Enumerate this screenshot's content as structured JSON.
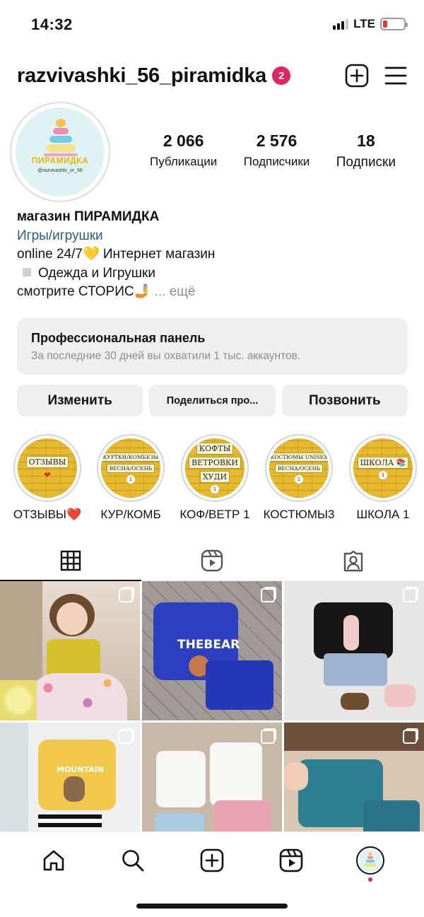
{
  "status": {
    "time": "14:32",
    "network": "LTE",
    "battery_color": "#e53935",
    "battery_level": 0.2
  },
  "header": {
    "username": "razvivashki_56_piramidka",
    "notifications": "2",
    "icons": [
      "new-post-icon",
      "menu-icon"
    ]
  },
  "profile": {
    "avatar": {
      "logo_text": "ПИРАМИДКА",
      "handle_text": "@razvivashki_or_56"
    },
    "stats": [
      {
        "value": "2 066",
        "label": "Публикации"
      },
      {
        "value": "2 576",
        "label": "Подписчики"
      },
      {
        "value": "18",
        "label": "Подписки"
      }
    ],
    "bio": {
      "name": "магазин ПИРАМИДКА",
      "category": "Игры/игрушки",
      "line1": "online 24/7💛 Интернет магазин",
      "line2": "Одежда и Игрушки",
      "line3": "смотрите СТОРИС🤳",
      "more": "... ещё"
    }
  },
  "pro_panel": {
    "title": "Профессиональная панель",
    "subtitle": "За последние 30 дней вы охватили 1 тыс. аккаунтов."
  },
  "buttons": {
    "edit": "Изменить",
    "share": "Поделиться про...",
    "call": "Позвонить"
  },
  "highlights": [
    {
      "label": "ОТЗЫВЫ❤️",
      "cover_lines": [
        "ОТЗЫВЫ",
        "❤"
      ]
    },
    {
      "label": "КУР/КОМБ",
      "cover_lines": [
        "КУРТКИ/КОМБЕЗЫ",
        "ВЕСНА/ОСЕНЬ",
        "1"
      ]
    },
    {
      "label": "КОФ/ВЕТР 1",
      "cover_lines": [
        "КОФТЫ",
        "ВЕТРОВКИ",
        "ХУДИ",
        "1"
      ]
    },
    {
      "label": "КОСТЮМЫ3",
      "cover_lines": [
        "КОСТЮМЫ UNISEX",
        "ВЕСНА/ОСЕНЬ",
        "1"
      ]
    },
    {
      "label": "ШКОЛА 1",
      "cover_lines": [
        "ШКОЛА 📚",
        "1"
      ]
    }
  ],
  "tabs": [
    "grid-icon",
    "reels-icon",
    "tagged-icon"
  ],
  "posts": [
    {
      "kind": "girl-in-floral-skirt",
      "multi": true
    },
    {
      "kind": "blue-shirt-thebear",
      "multi": true,
      "print_text": "THEBEAR"
    },
    {
      "kind": "black-shirt-bunny",
      "multi": true
    },
    {
      "kind": "yellow-shirt-mountain",
      "multi": true,
      "print_text": "MOUNTAIN"
    },
    {
      "kind": "white-tops-shorts",
      "multi": true
    },
    {
      "kind": "teal-tshirt-set",
      "multi": true
    }
  ],
  "bottom_nav": [
    "home-icon",
    "search-icon",
    "create-icon",
    "reels-icon",
    "profile-avatar"
  ]
}
